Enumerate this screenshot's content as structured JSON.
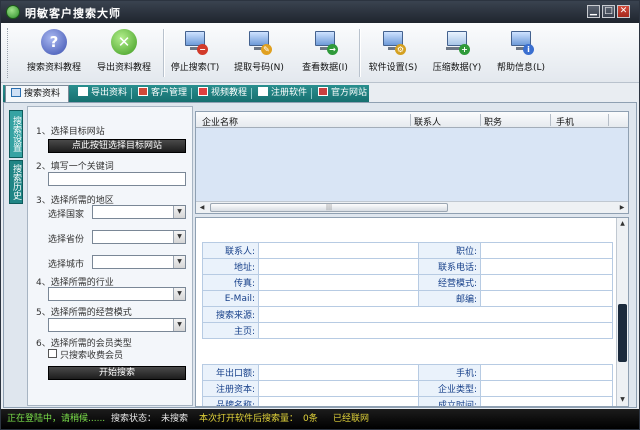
{
  "window": {
    "title": "明敏客户搜索大师"
  },
  "toolbar": {
    "buttons": [
      {
        "label": "搜索资料教程"
      },
      {
        "label": "导出资料教程"
      },
      {
        "label": "停止搜索(T)"
      },
      {
        "label": "提取号码(N)"
      },
      {
        "label": "查看数据(I)"
      },
      {
        "label": "软件设置(S)"
      },
      {
        "label": "压缩数据(Y)"
      },
      {
        "label": "帮助信息(L)"
      }
    ]
  },
  "tabs": [
    "搜索资料",
    "导出资料",
    "客户管理",
    "视频教程",
    "注册软件",
    "官方网站"
  ],
  "side_tabs": [
    "搜索设置",
    "搜索历史"
  ],
  "search": {
    "step1": "1、选择目标网站",
    "pick_site_button": "点此按钮选择目标网站",
    "step2": "2、填写一个关键词",
    "keyword_value": "",
    "step3": "3、选择所需的地区",
    "country_label": "选择国家",
    "province_label": "选择省份",
    "city_label": "选择城市",
    "step4": "4、选择所需的行业",
    "step5": "5、选择所需的经营模式",
    "step6": "6、选择所需的会员类型",
    "vip_only_label": "只搜索收费会员",
    "start_button": "开始搜索"
  },
  "results": {
    "columns": [
      "企业名称",
      "联系人",
      "职务",
      "手机"
    ]
  },
  "detail": {
    "section1": [
      [
        "联系人:",
        "",
        "职位:",
        ""
      ],
      [
        "地址:",
        "",
        "联系电话:",
        ""
      ],
      [
        "传真:",
        "",
        "经营模式:",
        ""
      ],
      [
        "E-Mail:",
        "",
        "邮编:",
        ""
      ]
    ],
    "source_label": "搜索来源:",
    "home_label": "主页:",
    "section2": [
      [
        "年出口额:",
        "",
        "手机:",
        ""
      ],
      [
        "注册资本:",
        "",
        "企业类型:",
        ""
      ],
      [
        "品牌名称:",
        "",
        "成立时间:",
        ""
      ]
    ]
  },
  "status": {
    "login": "正在登陆中，请稍候......",
    "search_state_label": "搜索状态：",
    "search_state": "未搜索",
    "count_text": "本次打开软件后搜索量：",
    "count_value": "0条",
    "network": "已经联网"
  },
  "colors": {
    "tab_teal": "#1b7b7b",
    "status_green": "#7be04a",
    "status_yellow": "#e0d23a",
    "detail_key": "#17408a"
  }
}
